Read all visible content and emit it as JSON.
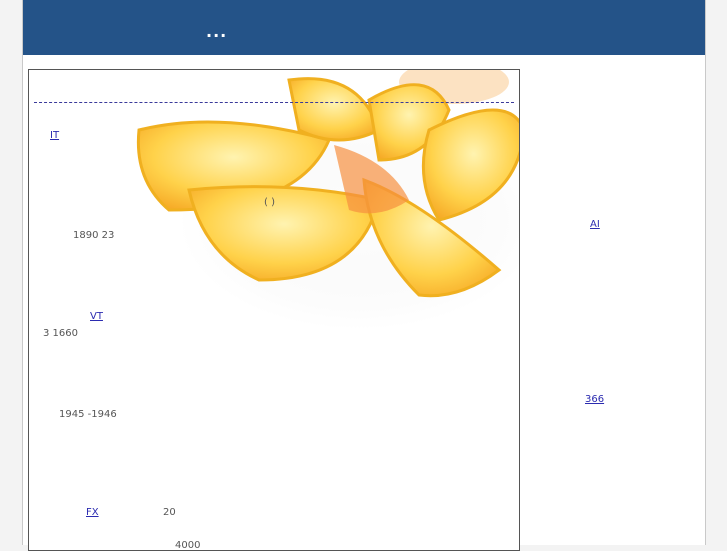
{
  "header": {
    "title": "..."
  },
  "main": {
    "links": [
      {
        "text": "  IT    "
      },
      {
        "text": "          "
      },
      {
        "text": "          "
      },
      {
        "text": "  "
      },
      {
        "text": "     "
      },
      {
        "text": "  "
      },
      {
        "text": "    "
      },
      {
        "text": "VT "
      },
      {
        "text": "     "
      },
      {
        "text": "   "
      },
      {
        "text": "   "
      },
      {
        "text": " "
      },
      {
        "text": "FX  "
      },
      {
        "text": "     "
      }
    ],
    "texts": [
      {
        "text": "( )"
      },
      {
        "text": "1890   23"
      },
      {
        "text": "3  1660"
      },
      {
        "text": "1945 -1946"
      },
      {
        "text": "20"
      },
      {
        "text": "4000"
      }
    ]
  },
  "sidebar": {
    "links": [
      {
        "text": "      "
      },
      {
        "text": "      "
      },
      {
        "text": "      "
      },
      {
        "text": "      "
      },
      {
        "text": "      "
      },
      {
        "text": "    "
      },
      {
        "text": "AI      "
      },
      {
        "text": "    "
      },
      {
        "text": "           "
      },
      {
        "text": "     "
      },
      {
        "text": "      "
      },
      {
        "text": "  "
      },
      {
        "text": "      "
      },
      {
        "text": "     "
      },
      {
        "text": "366        "
      },
      {
        "text": "      "
      },
      {
        "text": "    "
      },
      {
        "text": "      "
      },
      {
        "text": "      "
      }
    ]
  },
  "colors": {
    "header_bg": "#245388",
    "link": "#2b2bb0"
  }
}
